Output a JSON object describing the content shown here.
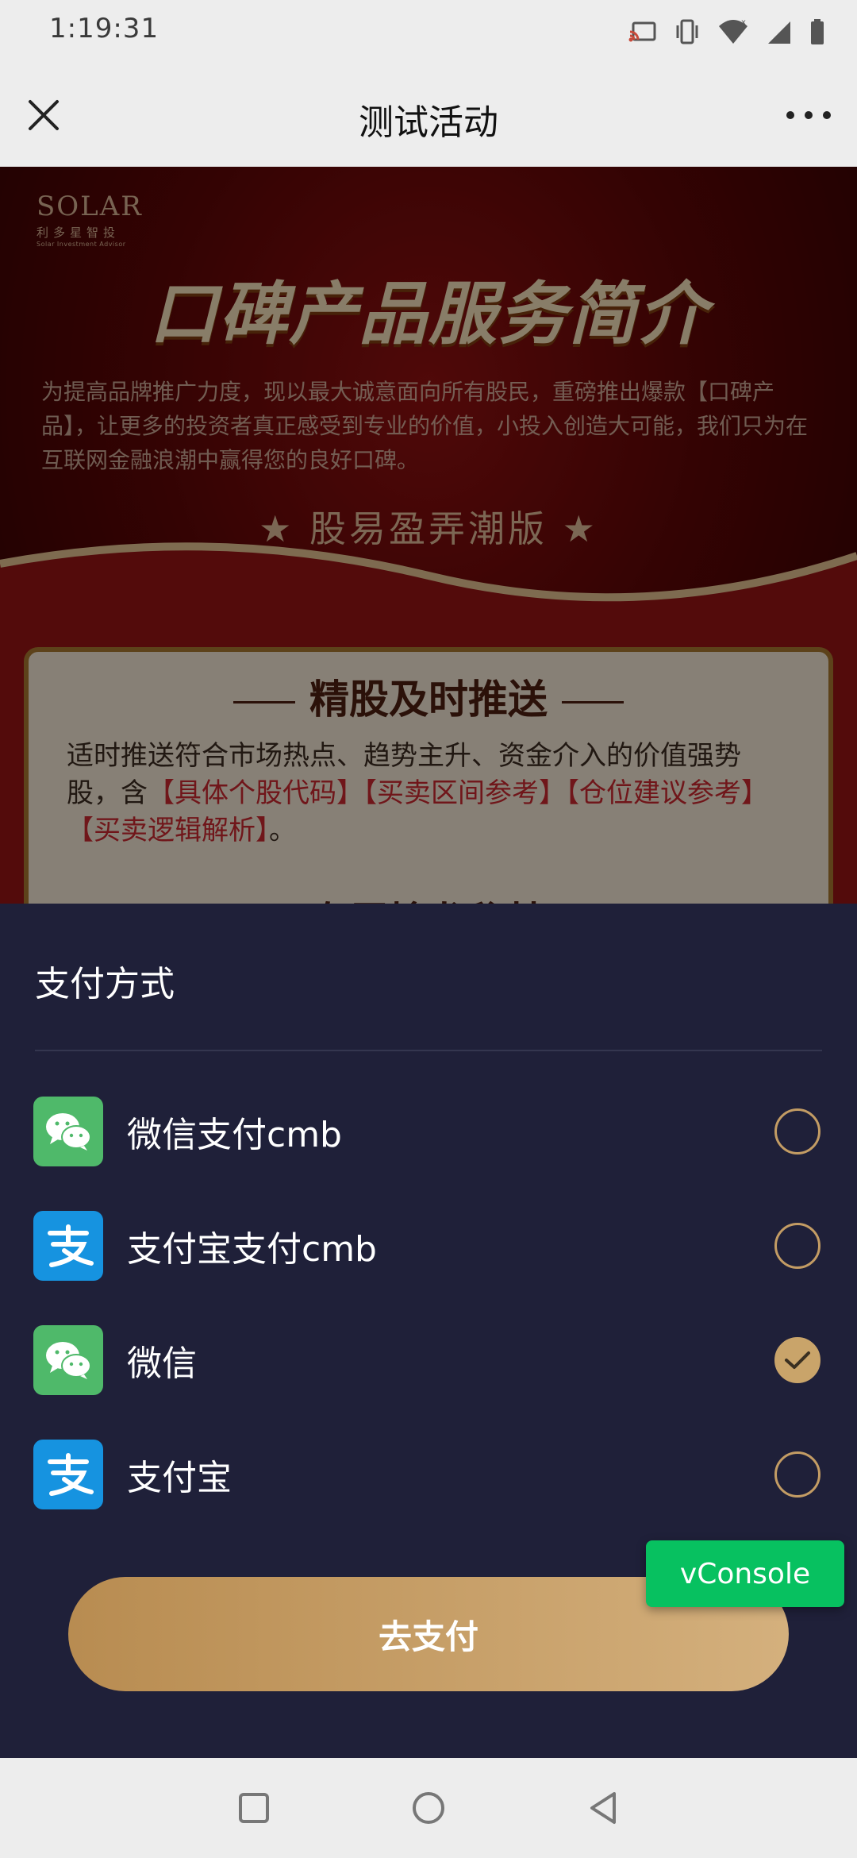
{
  "status_bar": {
    "time": "1:19:31",
    "icons": [
      "cast-icon",
      "vibrate-icon",
      "wifi-icon",
      "signal-icon",
      "battery-icon"
    ]
  },
  "nav": {
    "title": "测试活动",
    "close_icon": "close-icon",
    "more_icon": "more-icon"
  },
  "hero": {
    "logo_text": "SOLAR",
    "logo_sub": "利多星智投",
    "logo_tiny": "Solar Investment Advisor",
    "title": "口碑产品服务简介",
    "description": "为提高品牌推广力度，现以最大诚意面向所有股民，重磅推出爆款【口碑产品】，让更多的投资者真正感受到专业的价值，小投入创造大可能，我们只为在互联网金融浪潮中赢得您的良好口碑。",
    "edition": "★ 股易盈弄潮版 ★",
    "card": {
      "heading": "精股及时推送",
      "text_prefix": "适时推送符合市场热点、趋势主升、资金介入的价值强势股，含",
      "text_highlight": "【具体个股代码】【买卖区间参考】【仓位建议参考】【买卖逻辑解析】",
      "text_suffix": "。",
      "heading2": "专属擒龙秘技"
    }
  },
  "payment_sheet": {
    "title": "支付方式",
    "methods": [
      {
        "label": "微信支付cmb",
        "icon": "wechat-pay-icon",
        "selected": false
      },
      {
        "label": "支付宝支付cmb",
        "icon": "alipay-icon",
        "selected": false
      },
      {
        "label": "微信",
        "icon": "wechat-pay-icon",
        "selected": true
      },
      {
        "label": "支付宝",
        "icon": "alipay-icon",
        "selected": false
      }
    ],
    "submit_label": "去支付"
  },
  "vconsole_label": "vConsole",
  "colors": {
    "sheet_bg": "#1f2039",
    "accent_gold": "#c9a46a",
    "wechat_green": "#4fb96a",
    "alipay_blue": "#1693e0",
    "vconsole_green": "#07c160"
  }
}
